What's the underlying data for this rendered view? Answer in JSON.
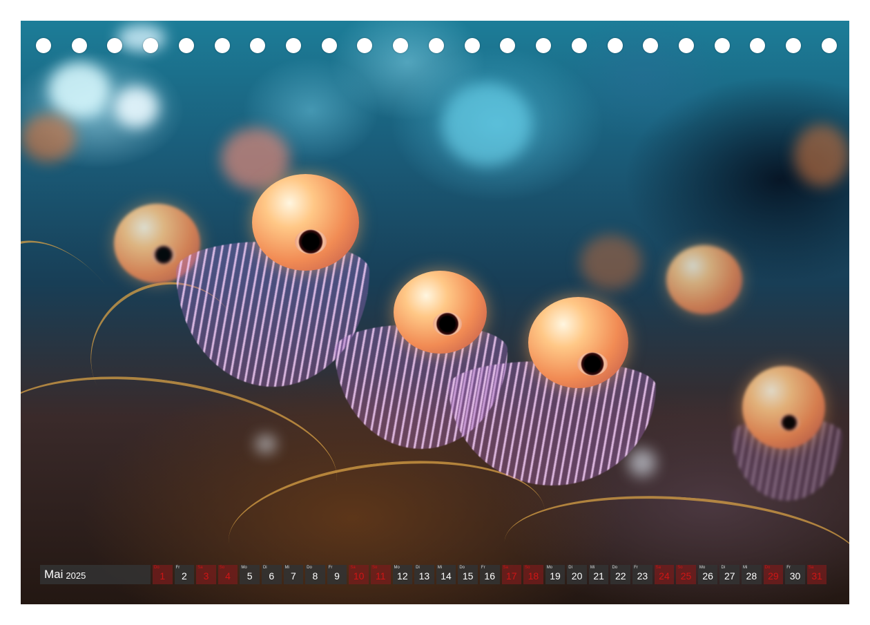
{
  "calendar": {
    "month": "Mai",
    "year": "2025",
    "days": [
      {
        "dow": "Do",
        "num": "1",
        "weekend": true
      },
      {
        "dow": "Fr",
        "num": "2",
        "weekend": false
      },
      {
        "dow": "Sa",
        "num": "3",
        "weekend": true
      },
      {
        "dow": "So",
        "num": "4",
        "weekend": true
      },
      {
        "dow": "Mo",
        "num": "5",
        "weekend": false
      },
      {
        "dow": "Di",
        "num": "6",
        "weekend": false
      },
      {
        "dow": "Mi",
        "num": "7",
        "weekend": false
      },
      {
        "dow": "Do",
        "num": "8",
        "weekend": false
      },
      {
        "dow": "Fr",
        "num": "9",
        "weekend": false
      },
      {
        "dow": "Sa",
        "num": "10",
        "weekend": true
      },
      {
        "dow": "So",
        "num": "11",
        "weekend": true
      },
      {
        "dow": "Mo",
        "num": "12",
        "weekend": false
      },
      {
        "dow": "Di",
        "num": "13",
        "weekend": false
      },
      {
        "dow": "Mi",
        "num": "14",
        "weekend": false
      },
      {
        "dow": "Do",
        "num": "15",
        "weekend": false
      },
      {
        "dow": "Fr",
        "num": "16",
        "weekend": false
      },
      {
        "dow": "Sa",
        "num": "17",
        "weekend": true
      },
      {
        "dow": "So",
        "num": "18",
        "weekend": true
      },
      {
        "dow": "Mo",
        "num": "19",
        "weekend": false
      },
      {
        "dow": "Di",
        "num": "20",
        "weekend": false
      },
      {
        "dow": "Mi",
        "num": "21",
        "weekend": false
      },
      {
        "dow": "Do",
        "num": "22",
        "weekend": false
      },
      {
        "dow": "Fr",
        "num": "23",
        "weekend": false
      },
      {
        "dow": "Sa",
        "num": "24",
        "weekend": true
      },
      {
        "dow": "So",
        "num": "25",
        "weekend": true
      },
      {
        "dow": "Mo",
        "num": "26",
        "weekend": false
      },
      {
        "dow": "Di",
        "num": "27",
        "weekend": false
      },
      {
        "dow": "Mi",
        "num": "28",
        "weekend": false
      },
      {
        "dow": "Do",
        "num": "29",
        "weekend": true
      },
      {
        "dow": "Fr",
        "num": "30",
        "weekend": false
      },
      {
        "dow": "Sa",
        "num": "31",
        "weekend": true
      }
    ]
  },
  "colors": {
    "weekend_red": "#d01515",
    "cell_gray": "#323232"
  }
}
